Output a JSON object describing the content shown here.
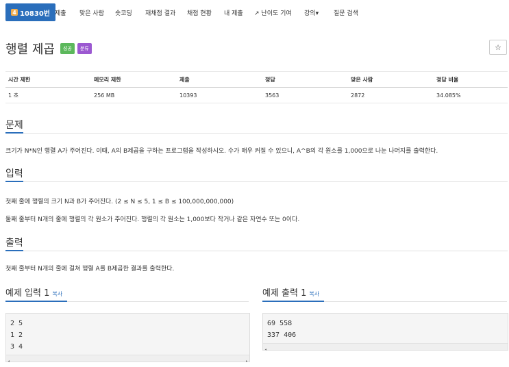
{
  "nav": {
    "active_num": "4",
    "active_label": "10830번",
    "items": [
      "제출",
      "맞은 사람",
      "숏코딩",
      "재채점 결과",
      "채점 현황",
      "내 제출",
      "난이도 기여",
      "강의",
      "질문 검색"
    ]
  },
  "problem": {
    "title": "행렬 제곱",
    "tag_success": "성공",
    "tag_category": "분류",
    "star": "☆"
  },
  "info_table": {
    "headers": [
      "시간 제한",
      "메모리 제한",
      "제출",
      "정답",
      "맞은 사람",
      "정답 비율"
    ],
    "values": [
      "1 초",
      "256 MB",
      "10393",
      "3563",
      "2872",
      "34.085%"
    ]
  },
  "sections": {
    "problem_heading": "문제",
    "problem_text": "크기가 N*N인 행렬 A가 주어진다. 이때, A의 B제곱을 구하는 프로그램을 작성하시오. 수가 매우 커질 수 있으니, A^B의 각 원소를 1,000으로 나눈 나머지를 출력한다.",
    "input_heading": "입력",
    "input_line1": "첫째 줄에 행렬의 크기 N과 B가 주어진다. (2 ≤ N ≤  5, 1 ≤ B ≤ 100,000,000,000)",
    "input_line2": "둘째 줄부터 N개의 줄에 행렬의 각 원소가 주어진다. 행렬의 각 원소는 1,000보다 작거나 같은 자연수 또는 0이다.",
    "output_heading": "출력",
    "output_text": "첫째 줄부터 N개의 줄에 걸쳐 행렬 A를 B제곱한 결과를 출력한다."
  },
  "samples": {
    "input_title": "예제 입력 1",
    "output_title": "예제 출력 1",
    "copy_label": "복사",
    "input_text": "2 5\n1 2\n3 4",
    "output_text": "69 558\n337 406"
  },
  "colors": {
    "accent": "#2a6ebb",
    "success": "#5cb85c",
    "category": "#9c59d1"
  }
}
